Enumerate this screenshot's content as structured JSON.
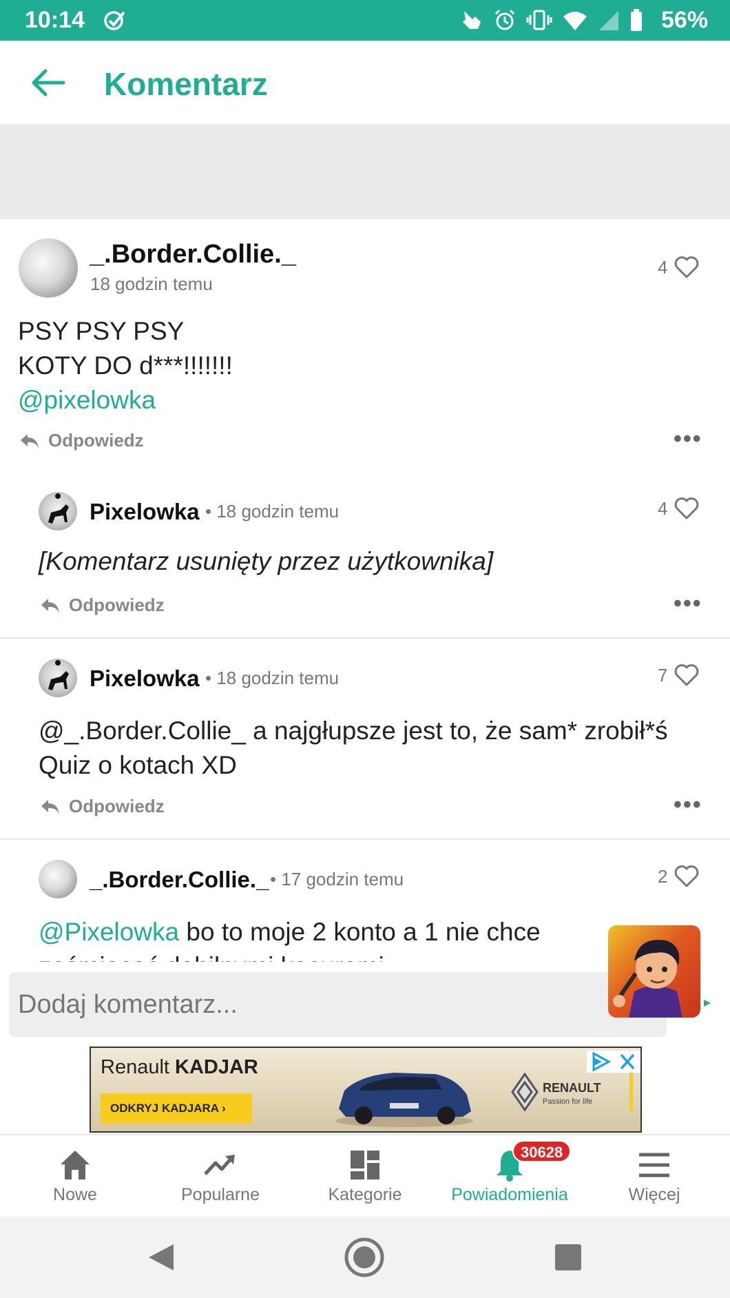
{
  "status_bar": {
    "time": "10:14",
    "battery": "56%"
  },
  "header": {
    "title": "Komentarz"
  },
  "comments": [
    {
      "username": "_.Border.Collie._",
      "time_ago": "18 godzin temu",
      "likes": "4",
      "lines": [
        "PSY PSY PSY",
        "KOTY DO d***!!!!!!!"
      ],
      "mention": "@pixelowka",
      "reply_label": "Odpowiedz"
    },
    {
      "username": "Pixelowka",
      "time_ago": "• 18 godzin temu",
      "likes": "4",
      "text": "[Komentarz usunięty przez użytkownika]",
      "reply_label": "Odpowiedz"
    },
    {
      "username": "Pixelowka",
      "time_ago": "• 18 godzin temu",
      "likes": "7",
      "line1": "@_.Border.Collie_ a najgłupsze jest to, że sam* zrobił*ś",
      "line2": "Quiz o kotach XD",
      "reply_label": "Odpowiedz"
    },
    {
      "username": "_.Border.Collie._",
      "time_ago": "• 17 godzin temu",
      "likes": "2",
      "mention": "@Pixelowka",
      "text": " bo to moje 2 konto a 1 nie chce",
      "text_cut": "zaśmiecać debilnymi kocurami"
    }
  ],
  "comment_input": {
    "placeholder": "Dodaj komentarz..."
  },
  "ad": {
    "brand_prefix": "Renault",
    "brand_model": "KADJAR",
    "cta": "ODKRYJ KADJARA  ›",
    "logo_text": "RENAULT",
    "logo_tagline": "Passion for life"
  },
  "bottom_nav": [
    {
      "label": "Nowe",
      "icon": "home-icon"
    },
    {
      "label": "Popularne",
      "icon": "trending-icon"
    },
    {
      "label": "Kategorie",
      "icon": "categories-icon"
    },
    {
      "label": "Powiadomienia",
      "icon": "bell-icon",
      "active": true
    },
    {
      "label": "Więcej",
      "icon": "menu-icon"
    }
  ],
  "notification_badge": "30628",
  "colors": {
    "accent": "#1fae94",
    "badge": "#e02424"
  }
}
